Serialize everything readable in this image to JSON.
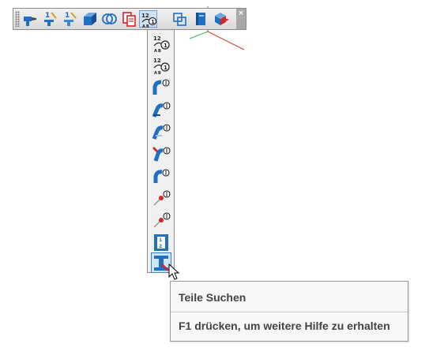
{
  "toolbar": {
    "close_glyph": "×",
    "buttons": [
      {
        "icon": "drill-hole-icon"
      },
      {
        "icon": "number-1-tool-icon"
      },
      {
        "icon": "number-1-tool-alt-icon"
      },
      {
        "icon": "blue-block-icon"
      },
      {
        "icon": "double-ring-icon"
      },
      {
        "icon": "red-copy-pages-icon"
      },
      {
        "icon": "balloon-12-icon"
      },
      {
        "icon": "square-frames-icon"
      },
      {
        "icon": "blue-book-icon"
      },
      {
        "icon": "red-blue-cube-icon"
      }
    ]
  },
  "flyout": {
    "items": [
      {
        "icon": "balloon-12-icon"
      },
      {
        "icon": "balloon-12-alt-icon"
      },
      {
        "icon": "blue-bend-tag-icon"
      },
      {
        "icon": "blue-bend-tag-2-icon"
      },
      {
        "icon": "blue-bend-tag-3-icon"
      },
      {
        "icon": "red-blue-bend-tag-icon"
      },
      {
        "icon": "blue-curve-tag-icon"
      },
      {
        "icon": "red-pin-tag-icon"
      },
      {
        "icon": "red-pin-tag-2-icon"
      },
      {
        "icon": "bracket-1-2-icon"
      },
      {
        "icon": "find-parts-icon"
      }
    ],
    "bracket_digits": {
      "top": "1",
      "bottom": "2"
    }
  },
  "balloon": {
    "top": "12",
    "left": "A",
    "right": "B",
    "circled": "1"
  },
  "tooltip": {
    "title": "Teile Suchen",
    "help": "F1 drücken, um weitere Hilfe zu erhalten"
  },
  "colors": {
    "accent_blue": "#1f6fc4",
    "accent_red": "#d3272a",
    "hover_blue": "#3a7bd5"
  }
}
